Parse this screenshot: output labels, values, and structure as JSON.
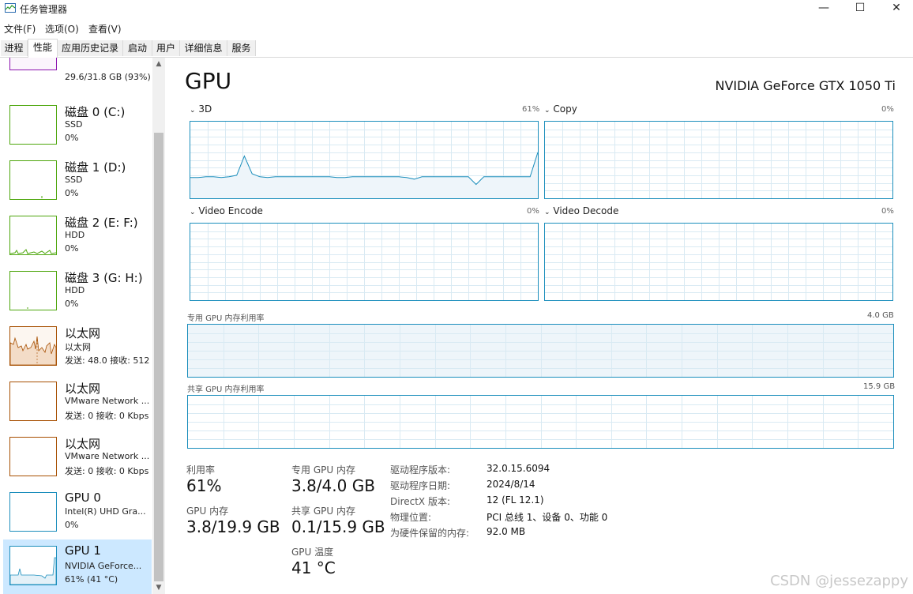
{
  "window": {
    "title": "任务管理器",
    "minimize": "—",
    "maximize": "☐",
    "close": "✕"
  },
  "menu": [
    "文件(F)",
    "选项(O)",
    "查看(V)"
  ],
  "tabs": [
    "进程",
    "性能",
    "应用历史记录",
    "启动",
    "用户",
    "详细信息",
    "服务"
  ],
  "active_tab": "性能",
  "sidebar": {
    "memory": {
      "sub1": "29.6/31.8 GB (93%)"
    },
    "items": [
      {
        "title": "磁盘 0 (C:)",
        "sub1": "SSD",
        "sub2": "0%"
      },
      {
        "title": "磁盘 1 (D:)",
        "sub1": "SSD",
        "sub2": "0%"
      },
      {
        "title": "磁盘 2 (E: F:)",
        "sub1": "HDD",
        "sub2": "0%"
      },
      {
        "title": "磁盘 3 (G: H:)",
        "sub1": "HDD",
        "sub2": "0%"
      },
      {
        "title": "以太网",
        "sub1": "以太网",
        "sub2": "发送: 48.0  接收: 512"
      },
      {
        "title": "以太网",
        "sub1": "VMware Network ...",
        "sub2": "发送: 0  接收: 0 Kbps"
      },
      {
        "title": "以太网",
        "sub1": "VMware Network ...",
        "sub2": "发送: 0  接收: 0 Kbps"
      },
      {
        "title": "GPU 0",
        "sub1": "Intel(R) UHD Gra...",
        "sub2": "0%"
      },
      {
        "title": "GPU 1",
        "sub1": "NVIDIA GeForce...",
        "sub2": "61% (41 °C)"
      }
    ]
  },
  "main": {
    "title": "GPU",
    "model": "NVIDIA GeForce GTX 1050 Ti",
    "engines": [
      {
        "name": "3D",
        "pct": "61%"
      },
      {
        "name": "Copy",
        "pct": "0%"
      },
      {
        "name": "Video Encode",
        "pct": "0%"
      },
      {
        "name": "Video Decode",
        "pct": "0%"
      }
    ],
    "dedicated_label": "专用 GPU 内存利用率",
    "dedicated_max": "4.0 GB",
    "shared_label": "共享 GPU 内存利用率",
    "shared_max": "15.9 GB",
    "stats": {
      "util_label": "利用率",
      "util_value": "61%",
      "gpu_mem_label": "GPU 内存",
      "gpu_mem_value": "3.8/19.9 GB",
      "ded_label": "专用 GPU 内存",
      "ded_value": "3.8/4.0 GB",
      "shared_label": "共享 GPU 内存",
      "shared_value": "0.1/15.9 GB",
      "temp_label": "GPU 温度",
      "temp_value": "41 °C"
    },
    "info": [
      {
        "label": "驱动程序版本:",
        "value": "32.0.15.6094"
      },
      {
        "label": "驱动程序日期:",
        "value": "2024/8/14"
      },
      {
        "label": "DirectX 版本:",
        "value": "12 (FL 12.1)"
      },
      {
        "label": "物理位置:",
        "value": "PCI 总线 1、设备 0、功能 0"
      },
      {
        "label": "为硬件保留的内存:",
        "value": "92.0 MB"
      }
    ]
  },
  "colors": {
    "gpu_line": "#1b8ebc",
    "gpu_fill": "#f1f6fa",
    "disk": "#4da60c",
    "ethernet": "#a74f01",
    "memory": "#8b12ae"
  },
  "watermark": "CSDN @jessezappy"
}
